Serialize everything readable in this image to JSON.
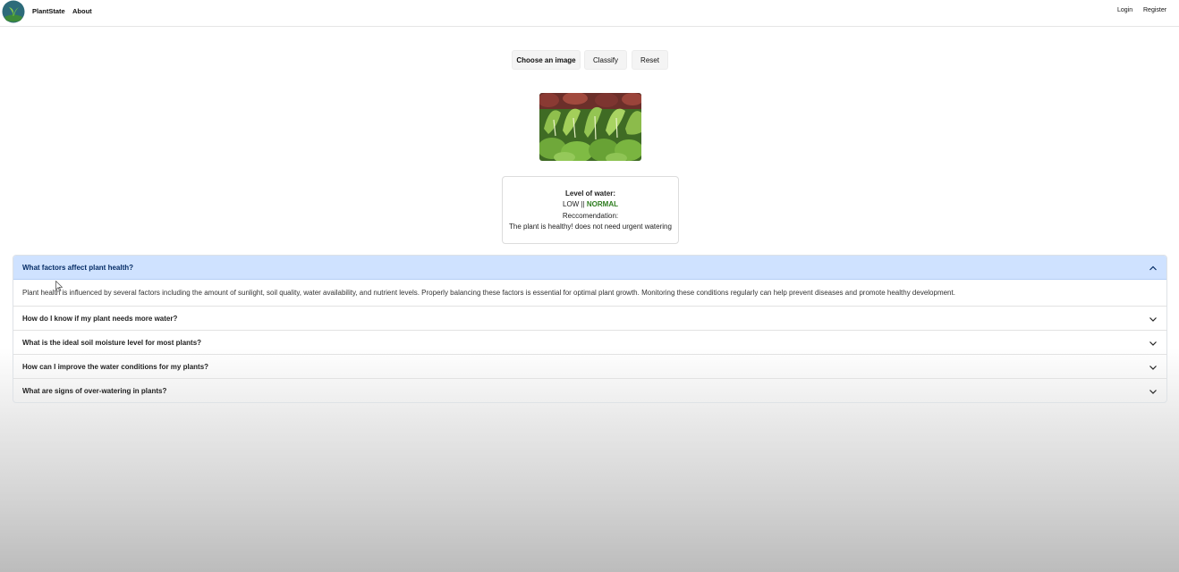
{
  "navbar": {
    "brand": "PlantState",
    "about": "About",
    "login": "Login",
    "register": "Register",
    "logo_icon": "plant-logo-icon"
  },
  "actions": {
    "choose_image": "Choose an image",
    "classify": "Classify",
    "reset": "Reset"
  },
  "result": {
    "heading": "Level of water:",
    "low": "LOW",
    "separator": "||",
    "normal": "NORMAL",
    "recommendation_label": "Reccomendation:",
    "recommendation_text": "The plant is healthy! does not need urgent watering",
    "normal_color": "#2e7d1f"
  },
  "faq": {
    "items": [
      {
        "question": "What factors affect plant health?",
        "answer": "Plant health is influenced by several factors including the amount of sunlight, soil quality, water availability, and nutrient levels. Properly balancing these factors is essential for optimal plant growth. Monitoring these conditions regularly can help prevent diseases and promote healthy development.",
        "expanded": true
      },
      {
        "question": "How do I know if my plant needs more water?",
        "expanded": false
      },
      {
        "question": "What is the ideal soil moisture level for most plants?",
        "expanded": false
      },
      {
        "question": "How can I improve the water conditions for my plants?",
        "expanded": false
      },
      {
        "question": "What are signs of over-watering in plants?",
        "expanded": false
      }
    ],
    "active_color": "#cfe2ff"
  }
}
